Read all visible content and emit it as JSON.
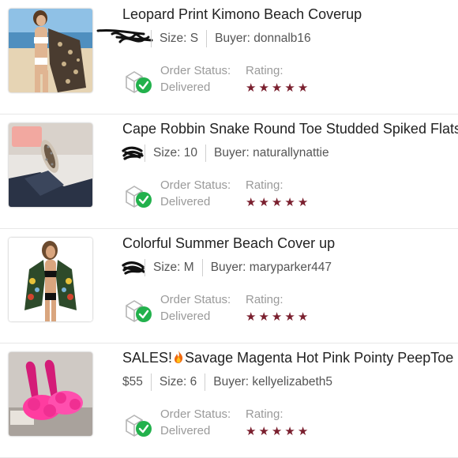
{
  "listings": [
    {
      "title": "Leopard Print Kimono Beach Coverup",
      "price": "",
      "size": "Size: S",
      "buyer": "Buyer: donnalb16",
      "status_label": "Order Status:",
      "status_value": "Delivered",
      "rating_label": "Rating:",
      "rating": 5,
      "thumb_icon": "beach-kimono-photo"
    },
    {
      "title": "Cape Robbin Snake Round Toe Studded Spiked Flats",
      "price": "",
      "size": "Size: 10",
      "buyer": "Buyer: naturallynattie",
      "status_label": "Order Status:",
      "status_value": "Delivered",
      "rating_label": "Rating:",
      "rating": 5,
      "thumb_icon": "snake-flats-photo"
    },
    {
      "title": "Colorful Summer Beach Cover up",
      "price": "",
      "size": "Size: M",
      "buyer": "Buyer: maryparker447",
      "status_label": "Order Status:",
      "status_value": "Delivered",
      "rating_label": "Rating:",
      "rating": 5,
      "thumb_icon": "cover-up-photo"
    },
    {
      "title_prefix": "SALES!",
      "title": "Savage Magenta Hot Pink Pointy PeepToe",
      "price": "$55",
      "size": "Size: 6",
      "buyer": "Buyer: kellyelizabeth5",
      "status_label": "Order Status:",
      "status_value": "Delivered",
      "rating_label": "Rating:",
      "rating": 5,
      "thumb_icon": "pink-heels-photo"
    }
  ],
  "colors": {
    "star": "#7a1f2e",
    "check_green": "#22b14c",
    "muted_text": "#9a9a9a"
  }
}
